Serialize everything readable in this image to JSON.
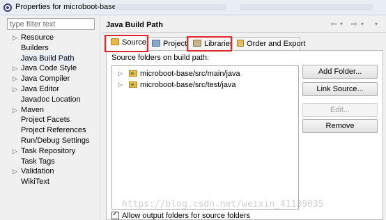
{
  "window": {
    "title": "Properties for microboot-base",
    "icon": "eclipse-icon"
  },
  "filter": {
    "placeholder": "type filter text"
  },
  "tree": {
    "items": [
      {
        "label": "Resource",
        "expandable": true
      },
      {
        "label": "Builders",
        "expandable": false
      },
      {
        "label": "Java Build Path",
        "expandable": false,
        "selected": true
      },
      {
        "label": "Java Code Style",
        "expandable": true
      },
      {
        "label": "Java Compiler",
        "expandable": true
      },
      {
        "label": "Java Editor",
        "expandable": true
      },
      {
        "label": "Javadoc Location",
        "expandable": false
      },
      {
        "label": "Maven",
        "expandable": true
      },
      {
        "label": "Project Facets",
        "expandable": false
      },
      {
        "label": "Project References",
        "expandable": false
      },
      {
        "label": "Run/Debug Settings",
        "expandable": false
      },
      {
        "label": "Task Repository",
        "expandable": true
      },
      {
        "label": "Task Tags",
        "expandable": false
      },
      {
        "label": "Validation",
        "expandable": true
      },
      {
        "label": "WikiText",
        "expandable": false
      }
    ]
  },
  "page": {
    "title": "Java Build Path",
    "nav": {
      "back": "⇦",
      "back_menu": "▾",
      "forward": "⇨",
      "forward_menu": "▾",
      "menu": "▾"
    }
  },
  "tabs": [
    {
      "label": "Source",
      "icon": "source-folder-icon",
      "active": true,
      "highlighted": true
    },
    {
      "label": "Projects",
      "icon": "projects-icon",
      "active": false
    },
    {
      "label": "Libraries",
      "icon": "libraries-icon",
      "active": false,
      "highlighted": true
    },
    {
      "label": "Order and Export",
      "icon": "order-export-icon",
      "active": false
    }
  ],
  "source_tab": {
    "list_label": "Source folders on build path:",
    "folders": [
      {
        "label": "microboot-base/src/main/java"
      },
      {
        "label": "microboot-base/src/test/java"
      }
    ],
    "buttons": {
      "add_folder": "Add Folder...",
      "link_source": "Link Source...",
      "edit": "Edit...",
      "remove": "Remove"
    },
    "allow_output_folders": {
      "label": "Allow output folders for source folders",
      "checked": true
    }
  },
  "watermark": "https://blog.csdn.net/weixin_41139035",
  "colors": {
    "highlight_border": "#e0282c",
    "selected_item_bg": "#e8eef7"
  }
}
